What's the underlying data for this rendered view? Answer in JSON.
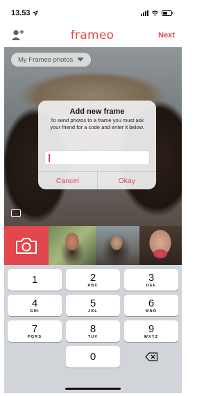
{
  "status_bar": {
    "time": "13.53"
  },
  "nav": {
    "logo": "frameo",
    "next_label": "Next"
  },
  "album_selector": {
    "label": "My Frameo photos"
  },
  "dialog": {
    "title": "Add new frame",
    "message": "To send photos to a frame you must ask your friend for a code and enter it below.",
    "input_value": "",
    "cancel_label": "Cancel",
    "okay_label": "Okay"
  },
  "colors": {
    "accent": "#e2474d",
    "keypad_bg": "#d1d4d9"
  },
  "keypad": {
    "keys": [
      {
        "number": "1",
        "letters": ""
      },
      {
        "number": "2",
        "letters": "ABC"
      },
      {
        "number": "3",
        "letters": "DEF"
      },
      {
        "number": "4",
        "letters": "GHI"
      },
      {
        "number": "5",
        "letters": "JKL"
      },
      {
        "number": "6",
        "letters": "MNO"
      },
      {
        "number": "7",
        "letters": "PQRS"
      },
      {
        "number": "8",
        "letters": "TUV"
      },
      {
        "number": "9",
        "letters": "WXYZ"
      },
      {
        "number": "0",
        "letters": ""
      }
    ]
  },
  "icons": {
    "add_user": "add-user-icon",
    "camera": "camera-icon",
    "backspace": "backspace-icon",
    "gallery": "gallery-icon",
    "location": "location-arrow-icon",
    "signal": "signal-icon",
    "wifi": "wifi-icon",
    "battery": "battery-icon"
  }
}
